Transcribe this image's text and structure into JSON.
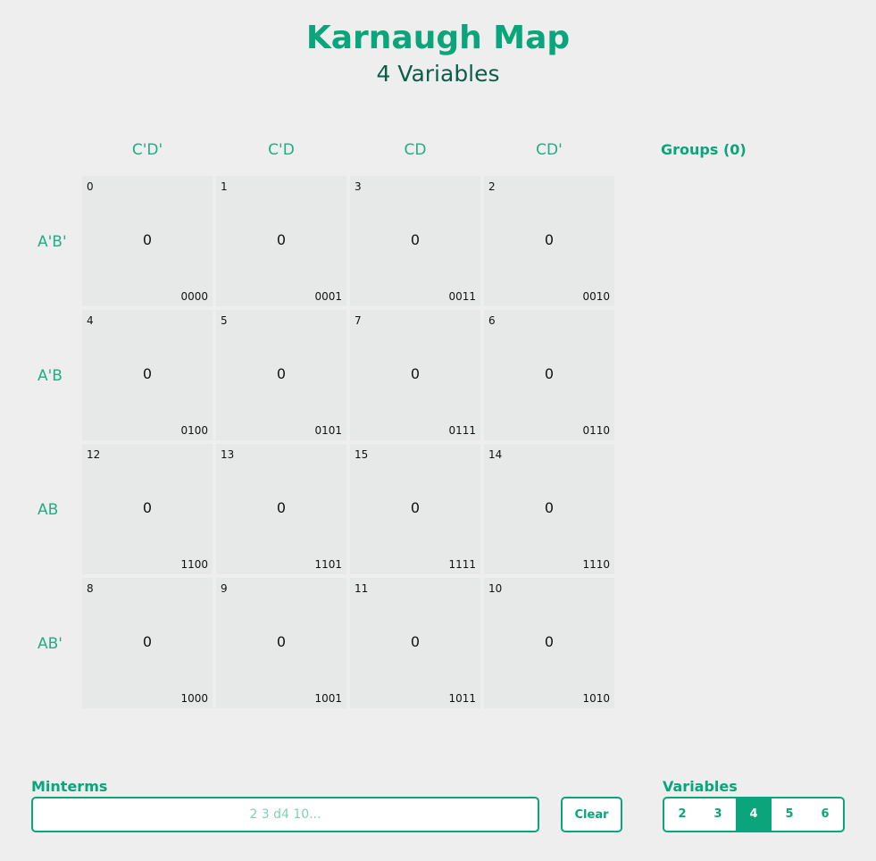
{
  "header": {
    "title": "Karnaugh Map",
    "subtitle": "4 Variables"
  },
  "map": {
    "col_headers": [
      "C'D'",
      "C'D",
      "CD",
      "CD'"
    ],
    "row_headers": [
      "A'B'",
      "A'B",
      "AB",
      "AB'"
    ],
    "rows": [
      [
        {
          "index": "0",
          "value": "0",
          "binary": "0000"
        },
        {
          "index": "1",
          "value": "0",
          "binary": "0001"
        },
        {
          "index": "3",
          "value": "0",
          "binary": "0011"
        },
        {
          "index": "2",
          "value": "0",
          "binary": "0010"
        }
      ],
      [
        {
          "index": "4",
          "value": "0",
          "binary": "0100"
        },
        {
          "index": "5",
          "value": "0",
          "binary": "0101"
        },
        {
          "index": "7",
          "value": "0",
          "binary": "0111"
        },
        {
          "index": "6",
          "value": "0",
          "binary": "0110"
        }
      ],
      [
        {
          "index": "12",
          "value": "0",
          "binary": "1100"
        },
        {
          "index": "13",
          "value": "0",
          "binary": "1101"
        },
        {
          "index": "15",
          "value": "0",
          "binary": "1111"
        },
        {
          "index": "14",
          "value": "0",
          "binary": "1110"
        }
      ],
      [
        {
          "index": "8",
          "value": "0",
          "binary": "1000"
        },
        {
          "index": "9",
          "value": "0",
          "binary": "1001"
        },
        {
          "index": "11",
          "value": "0",
          "binary": "1011"
        },
        {
          "index": "10",
          "value": "0",
          "binary": "1010"
        }
      ]
    ]
  },
  "groups": {
    "heading": "Groups (0)"
  },
  "minterms": {
    "label": "Minterms",
    "value": "",
    "placeholder": "2 3 d4 10..."
  },
  "clear_button": {
    "label": "Clear"
  },
  "variables": {
    "label": "Variables",
    "options": [
      "2",
      "3",
      "4",
      "5",
      "6"
    ],
    "selected": "4"
  },
  "colors": {
    "accent": "#0aa57a",
    "subtitle": "#0b5e47",
    "header_text": "#22ad85",
    "cell_bg": "#e7e9e8",
    "page_bg": "#eeeeee"
  }
}
